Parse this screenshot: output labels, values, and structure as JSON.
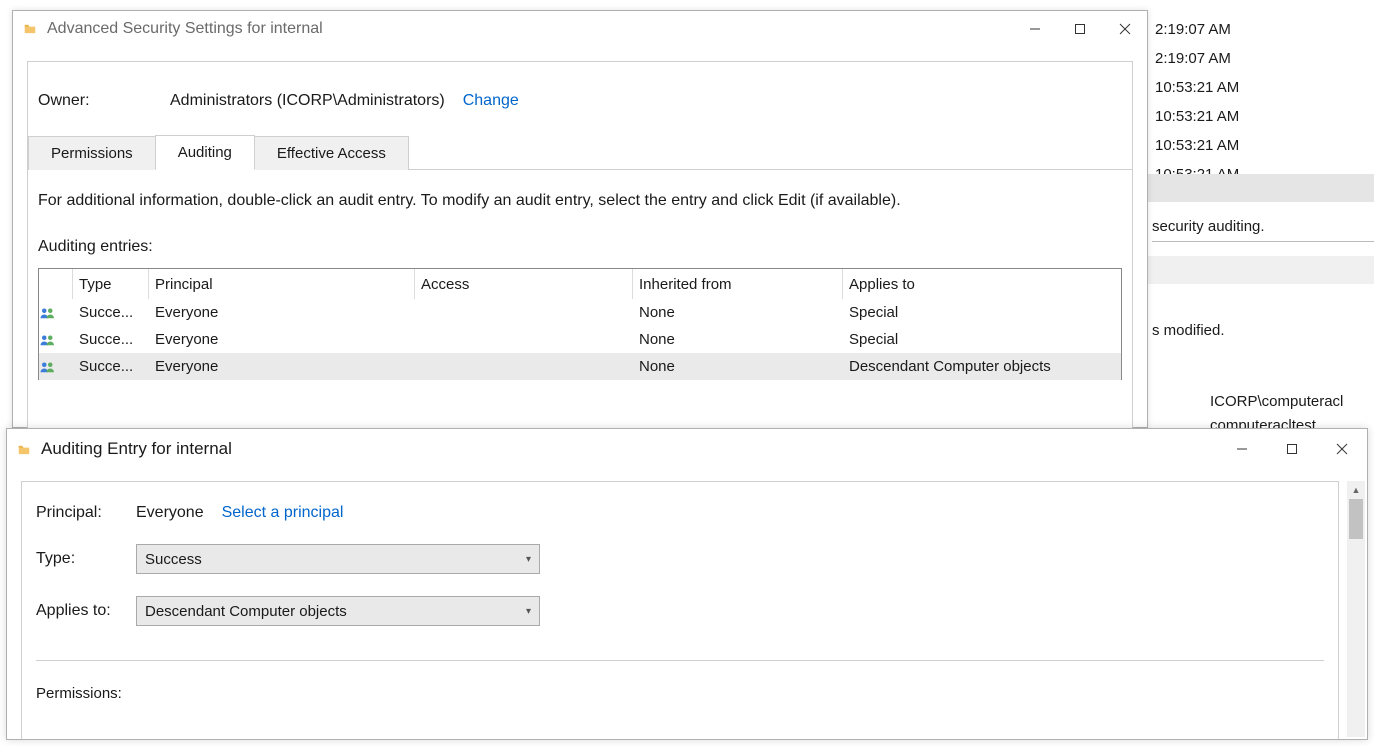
{
  "background": {
    "times": [
      "2:19:07 AM",
      "2:19:07 AM",
      "10:53:21 AM",
      "10:53:21 AM",
      "10:53:21 AM",
      "10:53:21 AM"
    ],
    "security_auditing_fragment": "security auditing.",
    "modified_fragment": "s modified.",
    "account1": "ICORP\\computeracl",
    "account2": "computeracltest"
  },
  "win1": {
    "title": "Advanced Security Settings for internal",
    "owner_label": "Owner:",
    "owner_value": "Administrators (ICORP\\Administrators)",
    "change_link": "Change",
    "tabs": {
      "permissions": "Permissions",
      "auditing": "Auditing",
      "effective": "Effective Access"
    },
    "instructions": "For additional information, double-click an audit entry. To modify an audit entry, select the entry and click Edit (if available).",
    "entries_label": "Auditing entries:",
    "columns": {
      "type": "Type",
      "principal": "Principal",
      "access": "Access",
      "inherited": "Inherited from",
      "applies": "Applies to"
    },
    "rows": [
      {
        "type": "Succe...",
        "principal": "Everyone",
        "access": "",
        "inherited": "None",
        "applies": "Special",
        "selected": false
      },
      {
        "type": "Succe...",
        "principal": "Everyone",
        "access": "",
        "inherited": "None",
        "applies": "Special",
        "selected": false
      },
      {
        "type": "Succe...",
        "principal": "Everyone",
        "access": "",
        "inherited": "None",
        "applies": "Descendant Computer objects",
        "selected": true
      }
    ]
  },
  "win2": {
    "title": "Auditing Entry for internal",
    "principal_label": "Principal:",
    "principal_value": "Everyone",
    "select_principal_link": "Select a principal",
    "type_label": "Type:",
    "type_value": "Success",
    "applies_label": "Applies to:",
    "applies_value": "Descendant Computer objects",
    "permissions_label": "Permissions:"
  }
}
